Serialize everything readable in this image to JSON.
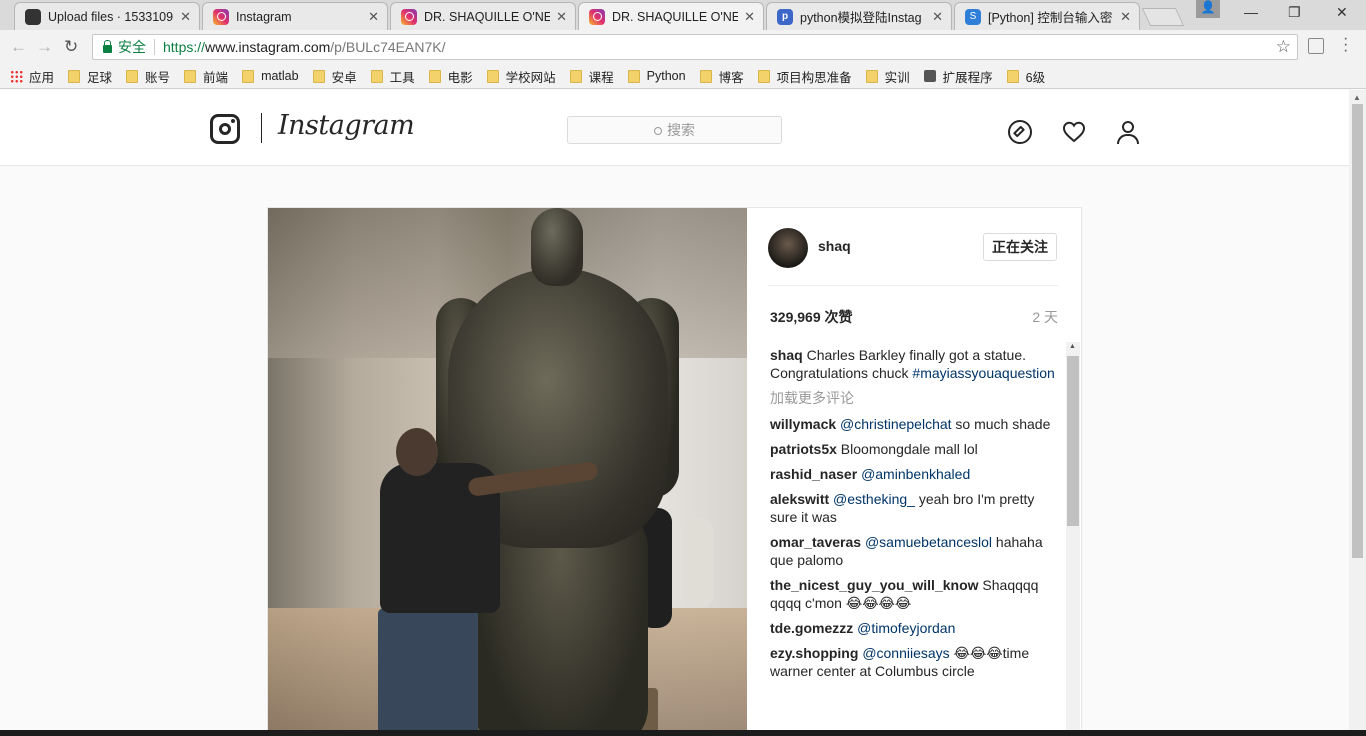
{
  "browser": {
    "tabs": [
      {
        "title": "Upload files · 1533109",
        "icon": "github-icon"
      },
      {
        "title": "Instagram",
        "icon": "instagram-icon"
      },
      {
        "title": "DR. SHAQUILLE O'NEA",
        "icon": "instagram-icon"
      },
      {
        "title": "DR. SHAQUILLE O'NEA",
        "icon": "instagram-icon",
        "active": true
      },
      {
        "title": "python模拟登陆Instag",
        "icon": "python-icon"
      },
      {
        "title": "[Python] 控制台输入密",
        "icon": "segmentfault-icon"
      }
    ],
    "close_glyph": "✕",
    "win_controls": {
      "minimize": "—",
      "restore": "❐",
      "close": "✕"
    },
    "secure_label": "安全",
    "url": {
      "scheme": "https://",
      "host": "www.instagram.com",
      "path": "/p/BULc74EAN7K/"
    },
    "bookmarks": [
      "应用",
      "足球",
      "账号",
      "前端",
      "matlab",
      "安卓",
      "工具",
      "电影",
      "学校网站",
      "课程",
      "Python",
      "博客",
      "项目构思准备",
      "实训",
      "扩展程序",
      "6级"
    ]
  },
  "instagram": {
    "wordmark": "Instagram",
    "search_placeholder": "搜索",
    "post": {
      "username": "shaq",
      "follow_label": "正在关注",
      "likes": "329,969 次赞",
      "time_ago": "2 天",
      "caption": {
        "user": "shaq",
        "text": "Charles Barkley finally got a statue. Congratulations chuck ",
        "hashtag": "#mayiassyouaquestion"
      },
      "load_more": "加载更多评论",
      "comments": [
        {
          "user": "willymack",
          "mention": "@christinepelchat",
          "text": " so much shade"
        },
        {
          "user": "patriots5x",
          "mention": "",
          "text": " Bloomongdale mall lol"
        },
        {
          "user": "rashid_naser",
          "mention": "@aminbenkhaled",
          "text": ""
        },
        {
          "user": "alekswitt",
          "mention": "@estheking_",
          "text": " yeah bro I'm pretty sure it was"
        },
        {
          "user": "omar_taveras",
          "mention": "@samuebetanceslol",
          "text": " hahaha que palomo"
        },
        {
          "user": "the_nicest_guy_you_will_know",
          "mention": "",
          "text": " Shaqqqq qqqq c'mon 😂😂😂😂"
        },
        {
          "user": "tde.gomezzz",
          "mention": "@timofeyjordan",
          "text": ""
        },
        {
          "user": "ezy.shopping",
          "mention": "@conniiesays",
          "text": " 😂😂😂time warner center at Columbus circle"
        }
      ]
    }
  }
}
